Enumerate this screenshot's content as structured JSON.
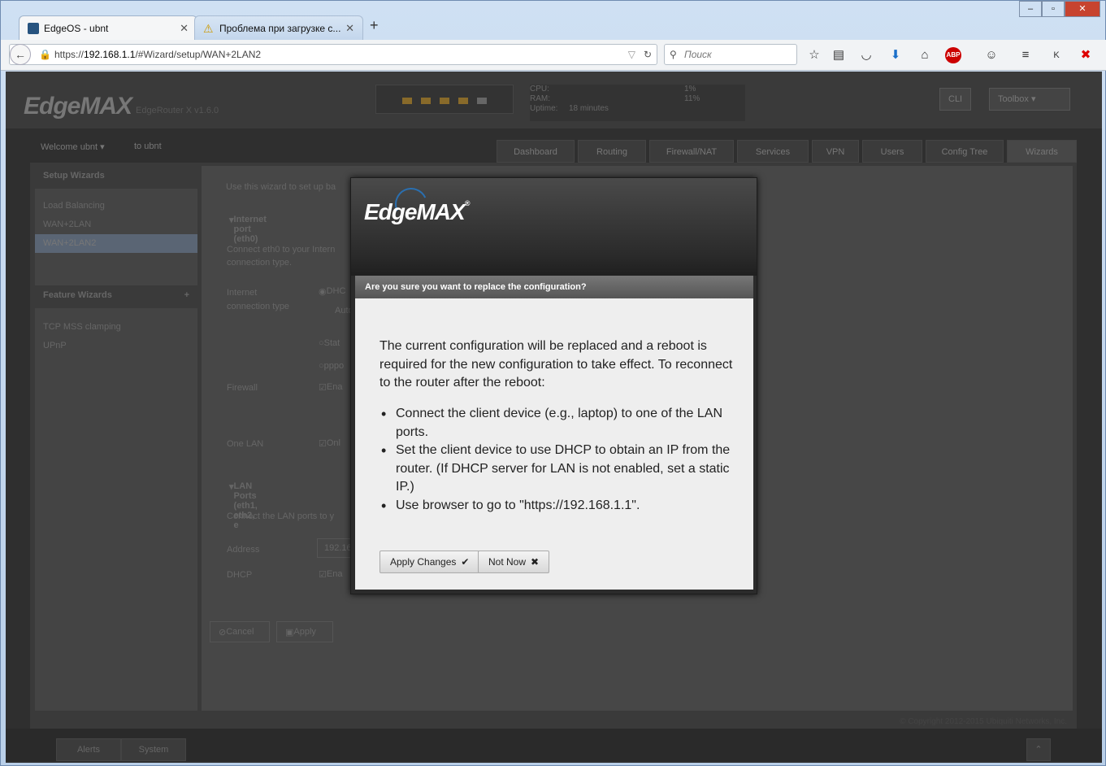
{
  "browser": {
    "tabs": [
      {
        "title": "EdgeOS - ubnt",
        "active": true
      },
      {
        "title": "Проблема при загрузке с...",
        "active": false
      }
    ],
    "new_tab": "+",
    "window_controls": {
      "minimize": "‒",
      "maximize": "▫",
      "close": "✕"
    },
    "url_prefix": "https://",
    "url_host": "192.168.1.1",
    "url_path": "/#Wizard/setup/WAN+2LAN2",
    "search_placeholder": "Поиск",
    "toolbar_icons": [
      "star-icon",
      "reader-icon",
      "pocket-icon",
      "download-icon",
      "home-icon",
      "adblock-icon",
      "chat-icon",
      "menu-icon",
      "k-icon",
      "x-icon"
    ],
    "adblock_label": "ABP"
  },
  "app": {
    "logo": "EdgeMAX",
    "model": "EdgeRouter X v1.6.0",
    "stats": {
      "cpu_label": "CPU:",
      "cpu_value": "1%",
      "ram_label": "RAM:",
      "ram_value": "11%",
      "uptime_label": "Uptime:",
      "uptime_value": "18 minutes"
    },
    "cli_label": "CLI",
    "toolbox_label": "Toolbox",
    "welcome": "Welcome ubnt",
    "to_ubnt": "to ubnt",
    "nav_tabs": [
      "Dashboard",
      "Routing",
      "Firewall/NAT",
      "Services",
      "VPN",
      "Users",
      "Config Tree",
      "Wizards"
    ],
    "sidebar": {
      "setup_header": "Setup Wizards",
      "setup_items": [
        "Load Balancing",
        "WAN+2LAN",
        "WAN+2LAN2"
      ],
      "feature_header": "Feature Wizards",
      "feature_add": "+",
      "feature_items": [
        "TCP MSS clamping",
        "UPnP"
      ]
    },
    "content": {
      "intro": "Use this wizard to set up ba",
      "internet_port": "Internet port (eth0)",
      "connect_text_1": "Connect eth0 to your Intern",
      "connect_text_2": "connection type.",
      "conn_type_label_1": "Internet",
      "conn_type_label_2": "connection type",
      "opt_dhcp": "DHC",
      "opt_auto": "Auto",
      "opt_static": "Stat",
      "opt_pppoe": "pppo",
      "firewall_label": "Firewall",
      "firewall_enable": "Ena",
      "one_lan_label": "One LAN",
      "one_lan_opt": "Onl",
      "lan_ports": "LAN Ports (eth1, eth2, e",
      "lan_connect": "Connect the LAN ports to y",
      "address_label": "Address",
      "address_value": "192.16",
      "dhcp_label": "DHCP",
      "dhcp_enable": "Ena",
      "cancel": "Cancel",
      "apply": "Apply"
    },
    "footer": {
      "copyright": "© Copyright 2012-2015 Ubiquiti Networks, Inc.",
      "alerts": "Alerts",
      "system": "System"
    }
  },
  "dialog": {
    "logo": "EdgeMAX",
    "logo_mark": "®",
    "title": "Are you sure you want to replace the configuration?",
    "message": "The current configuration will be replaced and a reboot is required for the new configuration to take effect. To reconnect to the router after the reboot:",
    "items": [
      "Connect the client device (e.g., laptop) to one of the LAN ports.",
      "Set the client device to use DHCP to obtain an IP from the router. (If DHCP server for LAN is not enabled, set a static IP.)",
      "Use browser to go to \"https://192.168.1.1\"."
    ],
    "apply_label": "Apply Changes",
    "not_now_label": "Not Now"
  }
}
